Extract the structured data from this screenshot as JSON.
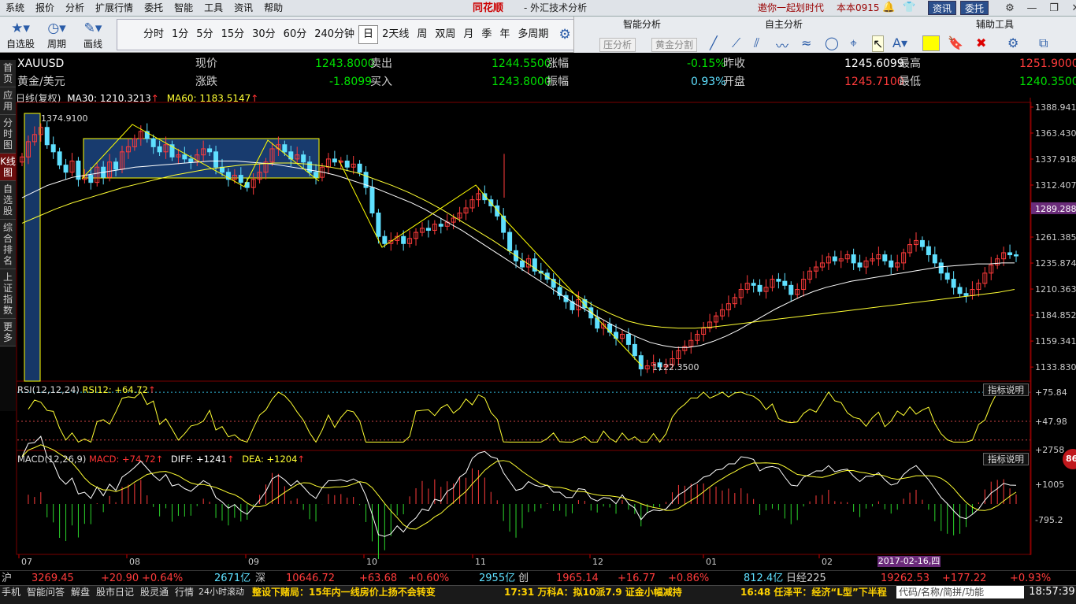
{
  "menu": [
    "系统",
    "报价",
    "分析",
    "扩展行情",
    "委托",
    "智能",
    "工具",
    "资讯",
    "帮助"
  ],
  "brand": "同花顺",
  "subtitle": "- 外汇技术分析",
  "invite": "邀你一起划时代",
  "version": "本本0915",
  "top_buttons": {
    "info": "资讯",
    "trade": "委托"
  },
  "toolbar": {
    "btn1": "自选股",
    "btn2": "周期",
    "btn3": "画线"
  },
  "periods": [
    "分时",
    "1分",
    "5分",
    "15分",
    "30分",
    "60分",
    "240分钟",
    "日",
    "2天线",
    "周",
    "双周",
    "月",
    "季",
    "年",
    "多周期"
  ],
  "selected_period": "日",
  "analysis": {
    "smart": "智能分析",
    "self": "自主分析",
    "aux": "辅助工具",
    "pressure": "压分析",
    "gold_split": "黄金分割"
  },
  "leftnav": [
    "首页",
    "应用",
    "分时图",
    "K线图",
    "自选股",
    "综合排名",
    "上证指数",
    "更多"
  ],
  "quote": {
    "symbol": "XAUUSD",
    "name": "黄金/美元",
    "now_label": "现价",
    "now": "1243.8000",
    "chg_label": "涨跌",
    "chg": "-1.8099",
    "sell_label": "卖出",
    "sell": "1244.5500",
    "buy_label": "买入",
    "buy": "1243.8000",
    "rate_label": "涨幅",
    "rate": "-0.15%",
    "amp_label": "振幅",
    "amp": "0.93%",
    "prev_label": "昨收",
    "prev": "1245.6099",
    "open_label": "开盘",
    "open": "1245.7100",
    "high_label": "最高",
    "high": "1251.9000",
    "low_label": "最低",
    "low": "1240.3500"
  },
  "chart_head": {
    "title": "日线(复权)",
    "ma30": "MA30: 1210.3213",
    "ma60": "MA60: 1183.5147"
  },
  "chart_data": {
    "type": "candlestick",
    "y_ticks": [
      "1388.941",
      "1363.430",
      "1337.918",
      "1312.407",
      "1289.288",
      "1261.385",
      "1235.874",
      "1210.363",
      "1184.852",
      "1159.341",
      "1133.830"
    ],
    "price_label": "1289.288",
    "high_mark": "1374.9100",
    "low_mark": "1122.3500",
    "x_labels": [
      "07",
      "08",
      "09",
      "10",
      "11",
      "12",
      "01",
      "02"
    ],
    "ylim": [
      1120,
      1392
    ],
    "closes": [
      1340,
      1355,
      1362,
      1369,
      1352,
      1345,
      1332,
      1325,
      1336,
      1318,
      1322,
      1315,
      1330,
      1320,
      1335,
      1328,
      1345,
      1350,
      1358,
      1365,
      1358,
      1350,
      1345,
      1352,
      1340,
      1342,
      1338,
      1335,
      1342,
      1348,
      1345,
      1330,
      1325,
      1318,
      1322,
      1315,
      1310,
      1318,
      1325,
      1335,
      1348,
      1352,
      1345,
      1338,
      1342,
      1335,
      1325,
      1320,
      1330,
      1338,
      1335,
      1336,
      1330,
      1333,
      1325,
      1310,
      1285,
      1262,
      1255,
      1258,
      1262,
      1255,
      1260,
      1266,
      1270,
      1268,
      1274,
      1272,
      1276,
      1280,
      1285,
      1290,
      1298,
      1304,
      1298,
      1292,
      1282,
      1266,
      1248,
      1238,
      1232,
      1240,
      1228,
      1226,
      1220,
      1212,
      1204,
      1198,
      1190,
      1200,
      1192,
      1182,
      1172,
      1176,
      1168,
      1162,
      1166,
      1156,
      1145,
      1132,
      1135,
      1138,
      1134,
      1136,
      1142,
      1150,
      1154,
      1160,
      1166,
      1172,
      1178,
      1184,
      1190,
      1196,
      1202,
      1210,
      1216,
      1214,
      1208,
      1212,
      1220,
      1218,
      1214,
      1205,
      1210,
      1220,
      1228,
      1232,
      1236,
      1242,
      1238,
      1240,
      1244,
      1236,
      1232,
      1238,
      1240,
      1244,
      1238,
      1232,
      1236,
      1246,
      1254,
      1258,
      1252,
      1244,
      1236,
      1226,
      1220,
      1212,
      1206,
      1204,
      1210,
      1216,
      1226,
      1234,
      1240,
      1246,
      1244,
      1243.8
    ],
    "ma30": [
      1300,
      1306,
      1312,
      1316,
      1320,
      1322,
      1324,
      1326,
      1328,
      1330,
      1331,
      1332,
      1333,
      1334,
      1335,
      1336,
      1336,
      1336,
      1335,
      1334,
      1333,
      1331,
      1329,
      1327,
      1325,
      1322,
      1318,
      1314,
      1310,
      1305,
      1300,
      1295,
      1289,
      1282,
      1275,
      1268,
      1260,
      1252,
      1244,
      1236,
      1228,
      1220,
      1212,
      1204,
      1196,
      1189,
      1182,
      1175,
      1169,
      1163,
      1158,
      1155,
      1153,
      1153,
      1155,
      1159,
      1164,
      1170,
      1177,
      1184,
      1191,
      1197,
      1203,
      1208,
      1212,
      1215,
      1218,
      1220,
      1222,
      1224,
      1226,
      1228,
      1230,
      1232,
      1233,
      1234,
      1235,
      1235,
      1236,
      1236
    ],
    "ma60": [
      1275,
      1282,
      1289,
      1295,
      1300,
      1305,
      1310,
      1314,
      1318,
      1322,
      1325,
      1328,
      1330,
      1332,
      1333,
      1334,
      1334,
      1333,
      1331,
      1328,
      1324,
      1318,
      1312,
      1305,
      1297,
      1288,
      1278,
      1268,
      1258,
      1247,
      1236,
      1225,
      1214,
      1204,
      1194,
      1186,
      1179,
      1175,
      1173,
      1172,
      1172,
      1173,
      1175,
      1177,
      1179,
      1181,
      1183,
      1185,
      1187,
      1189,
      1191,
      1193,
      1195,
      1197,
      1199,
      1201,
      1203,
      1205,
      1207,
      1210
    ],
    "rsi": {
      "label": "RSI(12,12,24)",
      "rsi12": "RSI12: +64.72",
      "ticks": [
        "+75.84",
        "+47.98"
      ]
    },
    "macd": {
      "label": "MACD(12,26,9)",
      "macd": "MACD: +74.72",
      "diff": "DIFF: +1241",
      "dea": "DEA: +1204",
      "ticks": [
        "+2758",
        "+1005",
        "-795.2"
      ]
    },
    "date_box": "2017-02-16,四"
  },
  "indicator_help": "指标说明",
  "badge": "86",
  "ticker": {
    "sh_label": "沪",
    "sh": "3269.45",
    "sh_chg": "+20.90",
    "sh_pct": "+0.64%",
    "sh_vol": "2671亿",
    "sz_label": "深",
    "sz": "10646.72",
    "sz_chg": "+63.68",
    "sz_pct": "+0.60%",
    "sz_vol": "2955亿",
    "cy_label": "创",
    "cy": "1965.14",
    "cy_chg": "+16.77",
    "cy_pct": "+0.86%",
    "cy_vol": "812.4亿",
    "nk_label": "日经225",
    "nk": "19262.53",
    "nk_chg": "+177.22",
    "nk_pct": "+0.93%"
  },
  "status": {
    "items": [
      "手机",
      "智能问答",
      "解盘",
      "股市日记",
      "股灵通",
      "行情",
      "24小时滚动"
    ],
    "news1": "整设下赌局：15年内一线房价上扬不会转变",
    "news2": "17:31 万科A：拟10派7.9 证金小幅减持",
    "news3": "16:48 任泽平：经济“L型”下半程",
    "search": "代码/名称/简拼/功能",
    "clock": "18:57:39"
  },
  "colors": {
    "up": "#ff3b3b",
    "down": "#5fe0ff",
    "ma30": "#ffffff",
    "ma60": "#ffff33",
    "macd_up": "#ff3b3b",
    "macd_down": "#2bd52b"
  }
}
